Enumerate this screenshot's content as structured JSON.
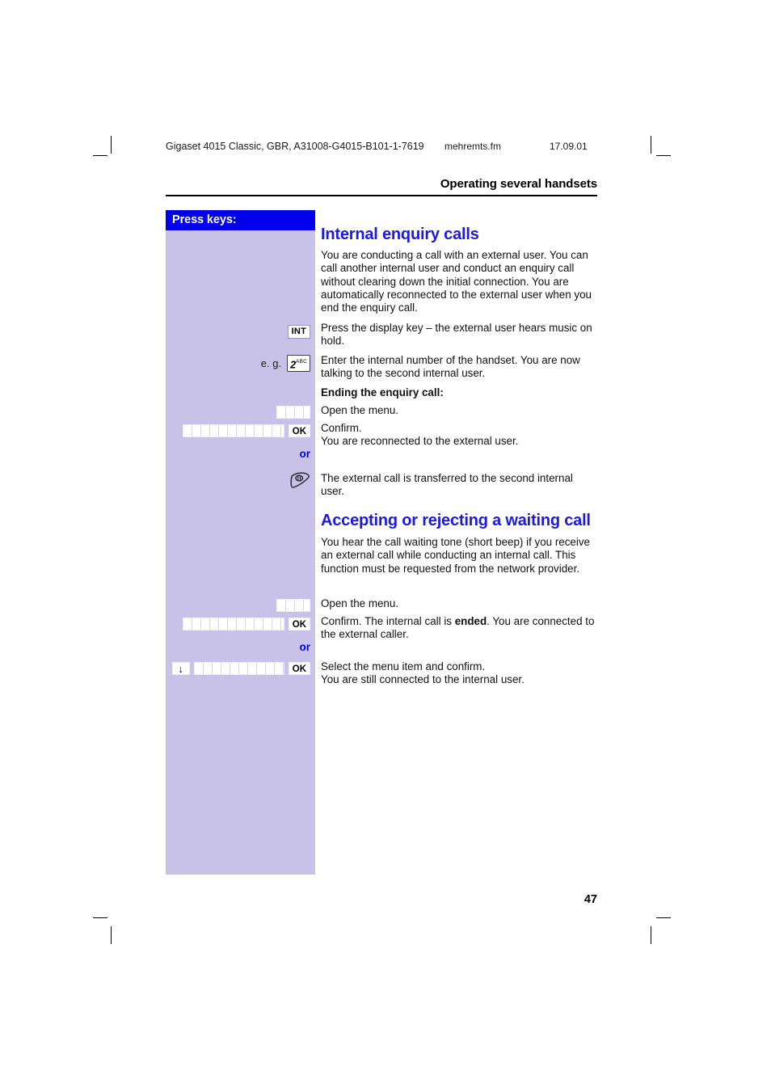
{
  "running_head": {
    "doc_id": "Gigaset 4015 Classic, GBR, A31008-G4015-B101-1-7619",
    "file_name": "mehremts.fm",
    "date": "17.09.01"
  },
  "chapter_header": "Operating several handsets",
  "key_column": {
    "title": "Press keys:",
    "eg_label": "e. g.",
    "int_key": "INT",
    "digit_key": {
      "digit": "2",
      "letters": "ABC"
    },
    "ok_label": "OK",
    "or_label": "or",
    "down_arrow": "↓",
    "end_call_icon": "end-call-icon"
  },
  "sections": [
    {
      "heading": "Internal enquiry calls",
      "paragraphs": [
        "You are conducting a call with an external user. You can call another internal user and conduct an enquiry call without clearing down the initial connection. You are automatically reconnected to the external user when you end the enquiry call.",
        "Press the display key  –  the external user hears music on hold.",
        "Enter the internal number of the handset. You are now talking to the second internal user.",
        "Ending the enquiry call:",
        "Open the menu.",
        "Confirm.",
        "You are reconnected to the external user.",
        "The external call is transferred to the second internal user."
      ]
    },
    {
      "heading": "Accepting or rejecting a waiting call",
      "paragraphs": [
        "You hear the call waiting tone (short beep) if you receive an external call while conducting an internal call. This function must be requested from the network provider.",
        "Open the menu.",
        "Confirm. The internal call is ",
        "ended",
        ". You are connected to the external caller.",
        "Select the menu item and confirm.",
        "You are still connected to the internal user."
      ]
    }
  ],
  "page_number": "47",
  "colors": {
    "accent_blue": "#1a1ae0",
    "header_bar": "#0000ee",
    "sidebar": "#c9c2e8"
  }
}
